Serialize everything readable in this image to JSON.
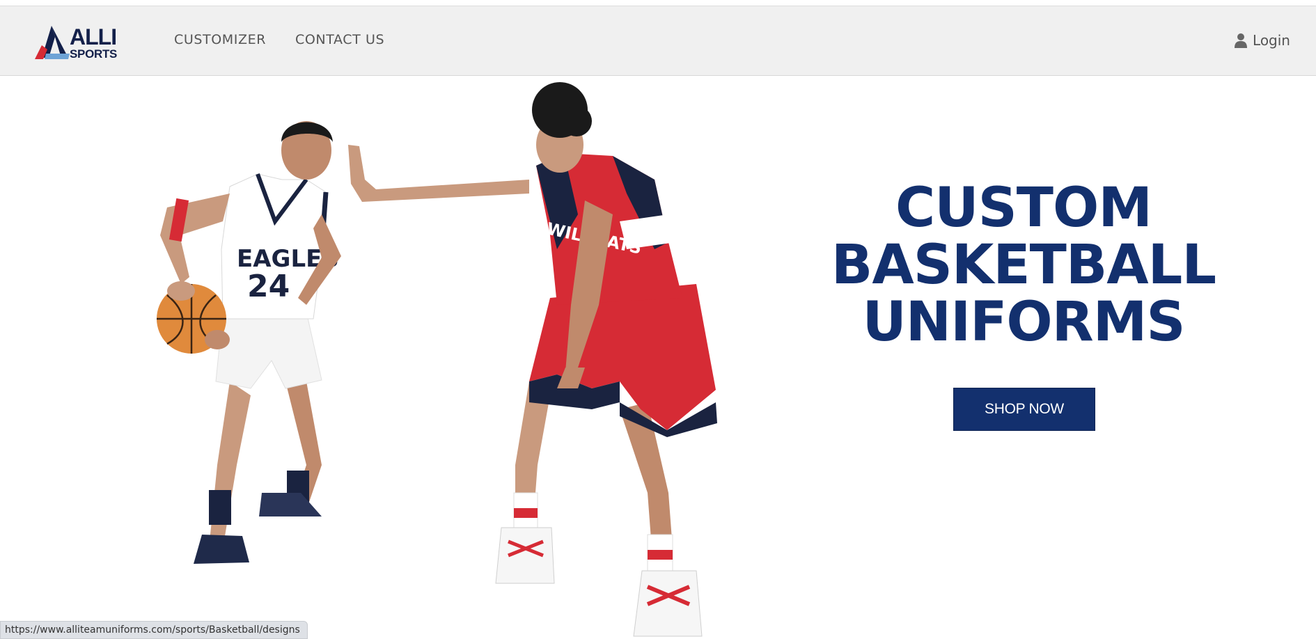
{
  "brand": {
    "logo_top": "ALLI",
    "logo_bottom": "SPORTS",
    "colors": {
      "navy": "#13204a",
      "red": "#d62b35",
      "blue": "#6ea3d6"
    }
  },
  "nav": {
    "links": [
      "CUSTOMIZER",
      "CONTACT US"
    ],
    "login_label": "Login",
    "login_icon": "user-icon"
  },
  "hero": {
    "headline": [
      "CUSTOM",
      "BASKETBALL",
      "UNIFORMS"
    ],
    "cta_label": "SHOP NOW",
    "left_player_jersey": {
      "team": "EAGLES",
      "number": "24"
    },
    "right_player_jersey": {
      "team": "WILDCATS"
    },
    "colors": {
      "headline": "#13306e",
      "button": "#13306e"
    }
  },
  "status": {
    "url": "https://www.alliteamuniforms.com/sports/Basketball/designs"
  }
}
